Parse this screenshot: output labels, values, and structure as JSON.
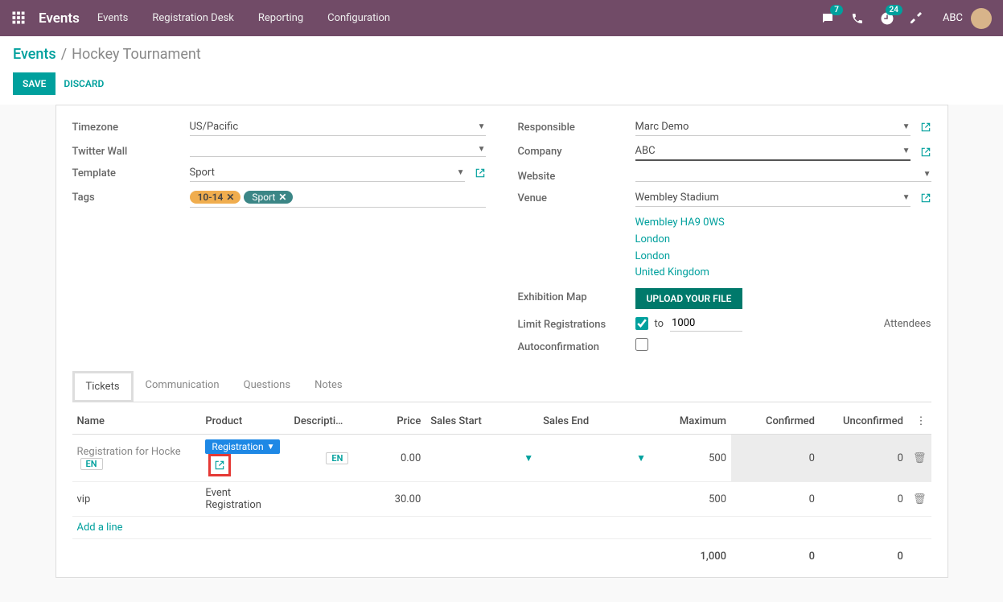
{
  "topnav": {
    "brand": "Events",
    "links": [
      "Events",
      "Registration Desk",
      "Reporting",
      "Configuration"
    ],
    "msg_badge": "7",
    "activity_badge": "24",
    "user": "ABC"
  },
  "breadcrumb": {
    "root": "Events",
    "sep": "/",
    "current": "Hockey Tournament"
  },
  "buttons": {
    "save": "SAVE",
    "discard": "DISCARD"
  },
  "form": {
    "left": {
      "timezone_label": "Timezone",
      "timezone": "US/Pacific",
      "twitter_label": "Twitter Wall",
      "twitter": "",
      "template_label": "Template",
      "template": "Sport",
      "tags_label": "Tags",
      "tags": [
        {
          "text": "10-14",
          "cls": "orange"
        },
        {
          "text": "Sport",
          "cls": "teal"
        }
      ]
    },
    "right": {
      "responsible_label": "Responsible",
      "responsible": "Marc Demo",
      "company_label": "Company",
      "company": "ABC",
      "website_label": "Website",
      "website": "",
      "venue_label": "Venue",
      "venue": "Wembley Stadium",
      "address": [
        "Wembley HA9 0WS",
        "London",
        "London",
        "United Kingdom"
      ],
      "exmap_label": "Exhibition Map",
      "upload": "UPLOAD YOUR FILE",
      "limit_label": "Limit Registrations",
      "limit_to": "to",
      "limit_val": "1000",
      "limit_unit": "Attendees",
      "autoconf_label": "Autoconfirmation"
    }
  },
  "tabs": [
    "Tickets",
    "Communication",
    "Questions",
    "Notes"
  ],
  "tickets": {
    "headers": {
      "name": "Name",
      "product": "Product",
      "desc": "Descripti…",
      "price": "Price",
      "start": "Sales Start",
      "end": "Sales End",
      "max": "Maximum",
      "conf": "Confirmed",
      "unconf": "Unconfirmed"
    },
    "rows": [
      {
        "name": "Registration for Hocke",
        "en1": "EN",
        "product": "Registration",
        "en2": "EN",
        "price": "0.00",
        "max": "500",
        "conf": "0",
        "unconf": "0",
        "selected": true
      },
      {
        "name": "vip",
        "en1": "",
        "product": "Event Registration",
        "en2": "",
        "price": "30.00",
        "max": "500",
        "conf": "0",
        "unconf": "0",
        "selected": false
      }
    ],
    "addline": "Add a line",
    "totals": {
      "max": "1,000",
      "conf": "0",
      "unconf": "0"
    }
  }
}
